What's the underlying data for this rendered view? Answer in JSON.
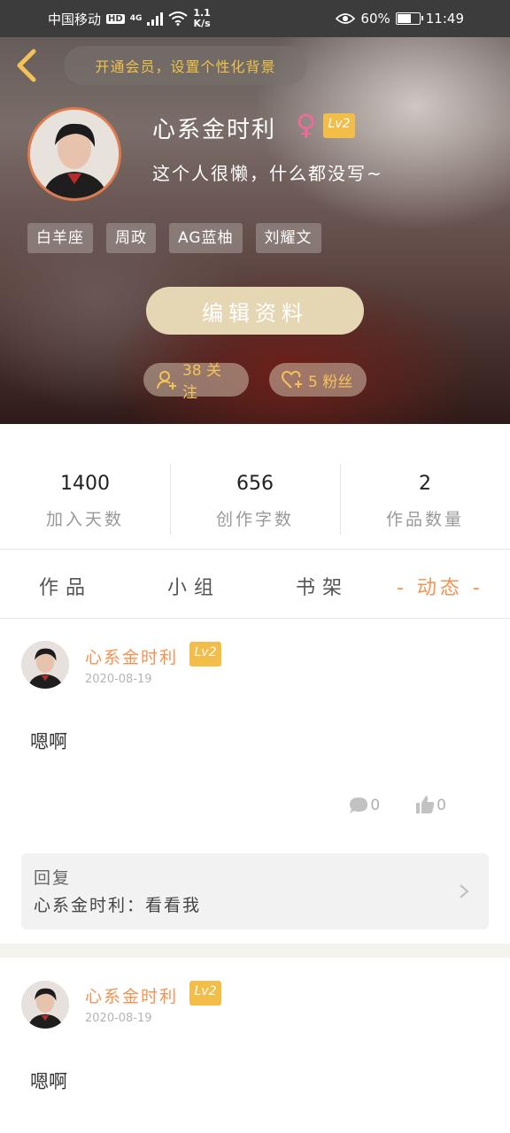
{
  "status_bar": {
    "carrier": "中国移动",
    "hd": "HD",
    "network": "4G",
    "speed_value": "1.1",
    "speed_unit": "K/s",
    "battery": "60%",
    "time": "11:49"
  },
  "header": {
    "vip_banner": "开通会员，设置个性化背景",
    "username": "心系金时利",
    "gender_symbol": "♀",
    "level": "Lv2",
    "bio": "这个人很懒，什么都没写~",
    "tags": [
      "白羊座",
      "周政",
      "AG蓝柚",
      "刘耀文"
    ],
    "edit_button": "编辑资料",
    "follow_label": "38 关注",
    "fans_label": "5 粉丝"
  },
  "stats": [
    {
      "value": "1400",
      "label": "加入天数"
    },
    {
      "value": "656",
      "label": "创作字数"
    },
    {
      "value": "2",
      "label": "作品数量"
    }
  ],
  "tabs": [
    {
      "label": "作品"
    },
    {
      "label": "小组"
    },
    {
      "label": "书架"
    },
    {
      "label": "- 动态 -"
    }
  ],
  "posts": [
    {
      "author": "心系金时利",
      "level": "Lv2",
      "date": "2020-08-19",
      "text": "嗯啊",
      "comment_count": "0",
      "like_count": "0",
      "reply_title": "回复",
      "reply_text": "心系金时利：看看我"
    },
    {
      "author": "心系金时利",
      "level": "Lv2",
      "date": "2020-08-19",
      "text": "嗯啊"
    }
  ],
  "colors": {
    "accent_orange": "#f29352",
    "level_badge": "#f3bd4a",
    "gender_pink": "#f06a9a",
    "vip_gold": "#f0c24a"
  },
  "icons": [
    "back-arrow-icon",
    "user-plus-icon",
    "heart-plus-icon",
    "comment-icon",
    "thumbs-up-icon",
    "chevron-right-icon"
  ]
}
